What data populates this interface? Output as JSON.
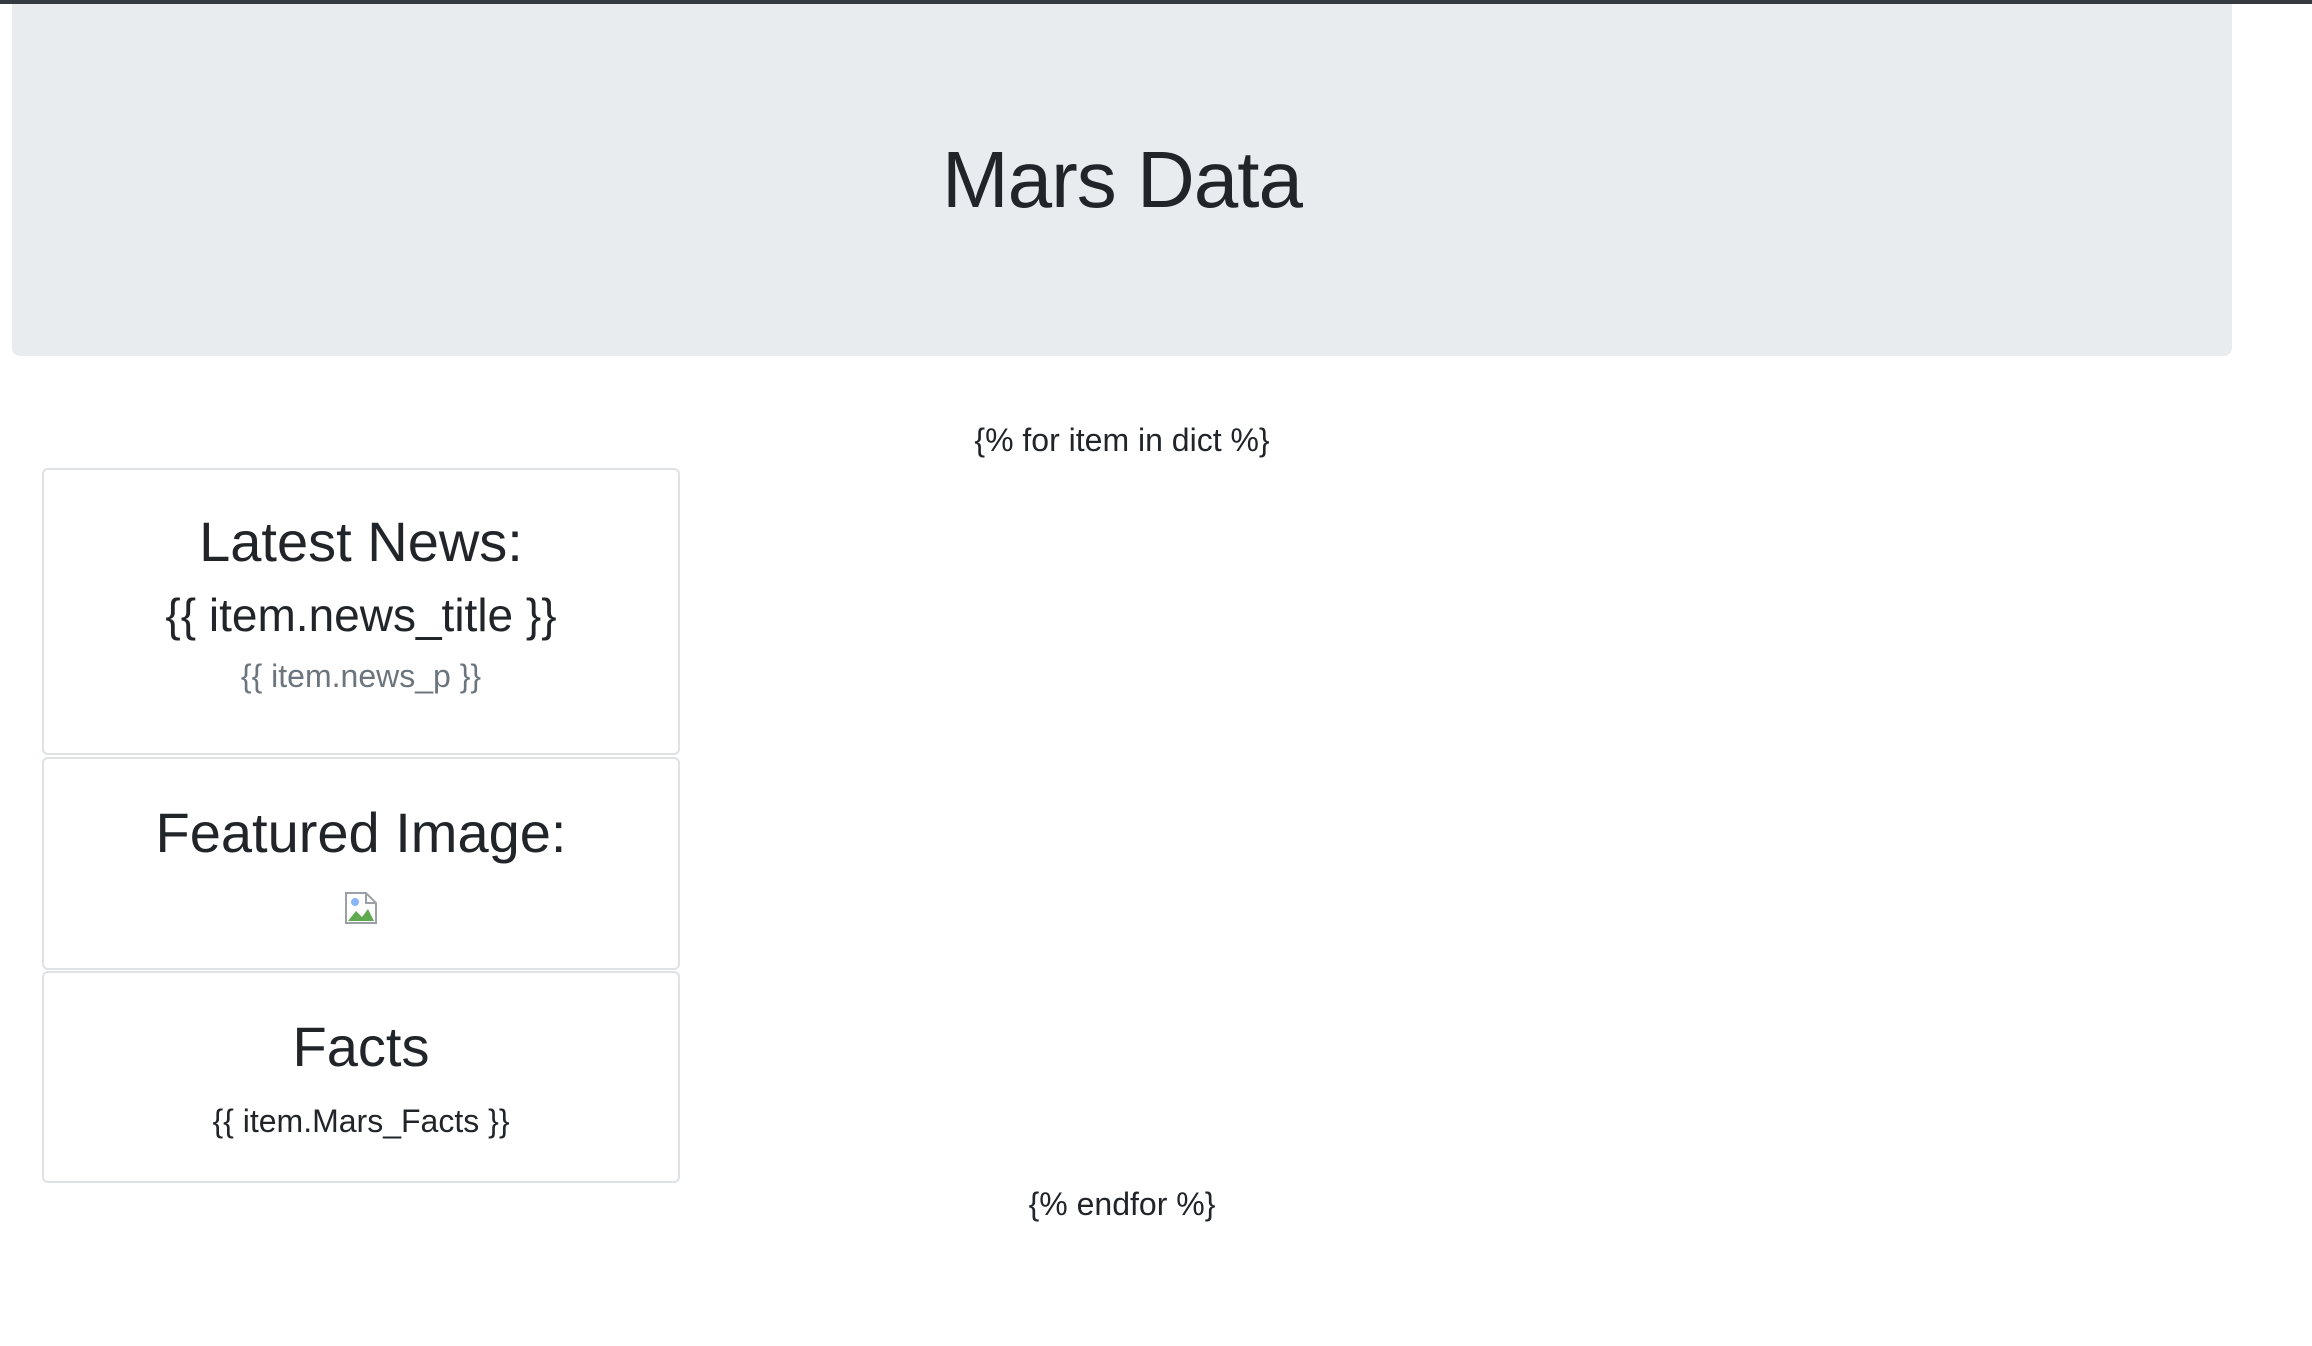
{
  "header": {
    "title": "Mars Data"
  },
  "template": {
    "for_line": "{% for item in dict %}",
    "endfor_line": "{% endfor %}"
  },
  "news_card": {
    "heading": "Latest News:",
    "title": "{{ item.news_title }}",
    "paragraph": "{{ item.news_p }}"
  },
  "image_card": {
    "heading": "Featured Image:",
    "image_icon": "broken-image-icon"
  },
  "facts_card": {
    "heading": "Facts",
    "text": "{{ item.Mars_Facts }}"
  },
  "colors": {
    "jumbotron_bg": "#e9ecef",
    "text": "#212529",
    "muted": "#6c757d",
    "card_border": "#dfe2e5"
  }
}
